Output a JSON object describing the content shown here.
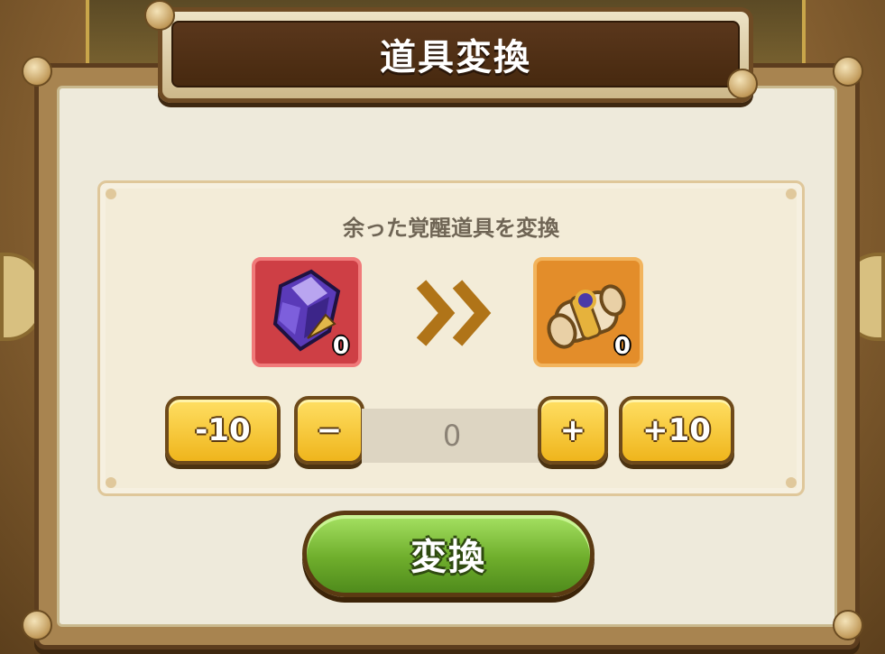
{
  "dialog": {
    "title": "道具変換"
  },
  "panel": {
    "subtitle": "余った覚醒道具を変換"
  },
  "source_item": {
    "icon": "purple-crystal-icon",
    "count": "0",
    "frame_color": "#ce3f45"
  },
  "target_item": {
    "icon": "scroll-icon",
    "count": "0",
    "frame_color": "#e38d2a"
  },
  "quantity": {
    "minus10_label": "-10",
    "minus_label": "−",
    "value": "0",
    "plus_label": "+",
    "plus10_label": "+10"
  },
  "actions": {
    "convert_label": "変換"
  },
  "colors": {
    "accent_green": "#6fae2c",
    "button_yellow": "#f4c231",
    "title_brown": "#4e2f14"
  }
}
